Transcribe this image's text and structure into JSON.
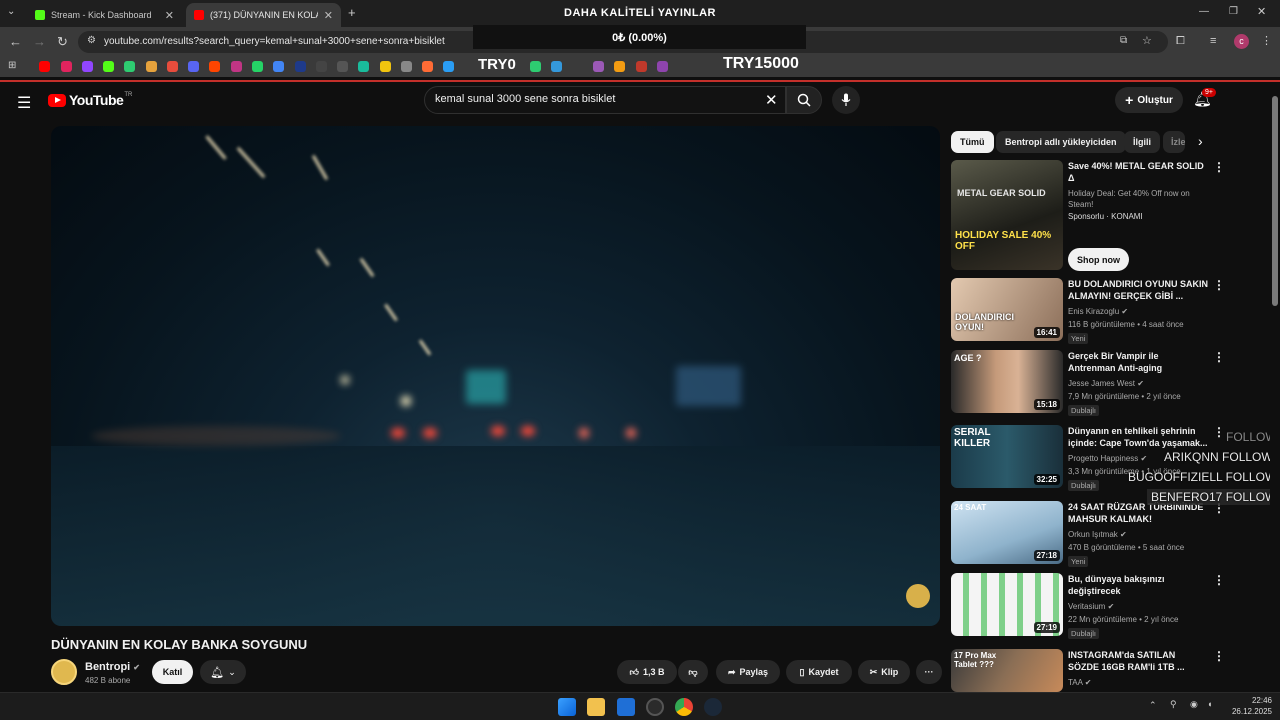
{
  "browser": {
    "tabs": [
      {
        "label": "Stream - Kick Dashboard",
        "favicon_color": "#53fc18"
      },
      {
        "label": "(371) DÜNYANIN EN KOLAY BA",
        "favicon_color": "#ff0000"
      }
    ],
    "new_tab_label": "+",
    "url": "youtube.com/results?search_query=kemal+sunal+3000+sene+sonra+bisiklet",
    "profile_initial": "c"
  },
  "stream_overlay": {
    "title": "DAHA KALİTELİ YAYINLAR",
    "progress": "0₺ (0.00%)",
    "try_small": "TRY0",
    "try_big": "TRY15000"
  },
  "youtube": {
    "logo": "YouTube",
    "logo_country": "TR",
    "search_value": "kemal sunal 3000 sene sonra bisiklet",
    "create_label": "Oluştur",
    "notif_badge": "9+"
  },
  "video": {
    "title": "DÜNYANIN EN KOLAY BANKA SOYGUNU",
    "channel": "Bentropi",
    "subscribers": "482 B abone",
    "join_label": "Katıl",
    "likes": "1,3 B",
    "share_label": "Paylaş",
    "save_label": "Kaydet",
    "clip_label": "Klip",
    "more_label": "···"
  },
  "chips": [
    "Tümü",
    "Bentropi adlı yükleyiciden",
    "İlgili",
    "İzle"
  ],
  "recommendations": [
    {
      "title": "Save 40%! METAL GEAR SOLID Δ",
      "line1": "Holiday Deal: Get 40% Off now on Steam!",
      "line2": "Sponsorlu · KONAMI",
      "duration": "",
      "badge": "",
      "shop": "Shop now",
      "thumb_text": "METAL GEAR SOLID",
      "thumb_sale": "HOLIDAY SALE 40% OFF"
    },
    {
      "title": "BU DOLANDIRICI OYUNU SAKIN ALMAYIN! GERÇEK GİBİ ...",
      "line1": "Enis Kirazoglu ✔",
      "line2": "116 B görüntüleme • 4 saat önce",
      "duration": "16:41",
      "badge": "Yeni",
      "thumb_text": "DOLANDIRICI OYUN!"
    },
    {
      "title": "Gerçek Bir Vampir ile Antrenman Anti-aging",
      "line1": "Jesse James West ✔",
      "line2": "7,9 Mn görüntüleme • 2 yıl önce",
      "duration": "15:18",
      "badge": "Dublajlı",
      "thumb_text": "AGE ?"
    },
    {
      "title": "Dünyanın en tehlikeli şehrinin içinde: Cape Town'da yaşamak...",
      "line1": "Progetto Happiness ✔",
      "line2": "3,3 Mn görüntüleme • 1 yıl önce",
      "duration": "32:25",
      "badge": "Dublajlı",
      "thumb_text": "SERIAL KILLER"
    },
    {
      "title": "24 SAAT RÜZGAR TÜRBİNİNDE MAHSUR KALMAK!",
      "line1": "Orkun Işıtmak ✔",
      "line2": "470 B görüntüleme • 5 saat önce",
      "duration": "27:18",
      "badge": "Yeni",
      "thumb_text": "24 SAAT"
    },
    {
      "title": "Bu, dünyaya bakışınızı değiştirecek",
      "line1": "Veritasium ✔",
      "line2": "22 Mn görüntüleme • 2 yıl önce",
      "duration": "27:19",
      "badge": "Dublajlı",
      "thumb_text": ""
    },
    {
      "title": "INSTAGRAM'da SATILAN SÖZDE 16GB RAM'li 1TB ...",
      "line1": "TAA ✔",
      "line2": "",
      "duration": "",
      "badge": "",
      "thumb_text": "17 Pro Max Tablet ???"
    }
  ],
  "follow_overlay": [
    {
      "name": "",
      "action": "FOLLOW"
    },
    {
      "name": "ARIKQNN",
      "action": "FOLLOW"
    },
    {
      "name": "BUGOOFFIZIELL",
      "action": "FOLLOW"
    },
    {
      "name": "BENFERO17",
      "action": "FOLLOW"
    }
  ],
  "taskbar": {
    "time": "22:46",
    "date": "26.12.2025"
  }
}
